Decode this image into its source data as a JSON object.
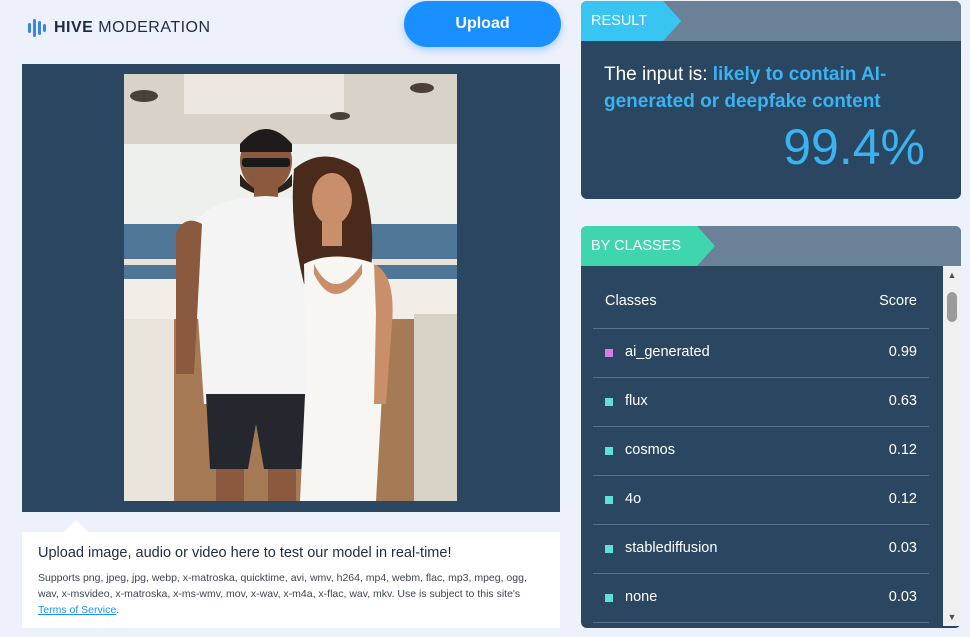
{
  "brand": {
    "bold": "HIVE",
    "light": "MODERATION"
  },
  "upload_button": "Upload",
  "upload_note": {
    "title": "Upload image, audio or video here to test our model in real-time!",
    "supports": "Supports png, jpeg, jpg, webp, x-matroska, quicktime, avi, wmv, h264, mp4, webm, flac, mp3, mpeg, ogg, wav, x-msvideo, x-matroska, x-ms-wmv, mov, x-wav, x-m4a, x-flac, wav, mkv. Use is subject to this site's",
    "tos_link": "Terms of Service",
    "tos_end": "."
  },
  "result": {
    "tag": "RESULT",
    "prefix": "The input is:",
    "verdict": "likely to contain AI-generated or deepfake content",
    "confidence": "99.4%"
  },
  "classes": {
    "tag": "BY CLASSES",
    "col_class": "Classes",
    "col_score": "Score",
    "rows": [
      {
        "name": "ai_generated",
        "score": "0.99",
        "color": "#d67ee6"
      },
      {
        "name": "flux",
        "score": "0.63",
        "color": "#5fe0d4"
      },
      {
        "name": "cosmos",
        "score": "0.12",
        "color": "#5fe0d4"
      },
      {
        "name": "4o",
        "score": "0.12",
        "color": "#5fe0d4"
      },
      {
        "name": "stablediffusion",
        "score": "0.03",
        "color": "#5fe0d4"
      },
      {
        "name": "none",
        "score": "0.03",
        "color": "#5fe0d4"
      }
    ]
  },
  "colors": {
    "accent": "#1a8fff",
    "panel": "#2a4660",
    "result_tag": "#38c5f2",
    "classes_tag": "#3fd6ae",
    "highlight": "#3ab3f2"
  },
  "icons": {
    "logo": "hive-logo-icon",
    "scroll_up": "scroll-up-arrow-icon",
    "scroll_down": "scroll-down-arrow-icon"
  }
}
